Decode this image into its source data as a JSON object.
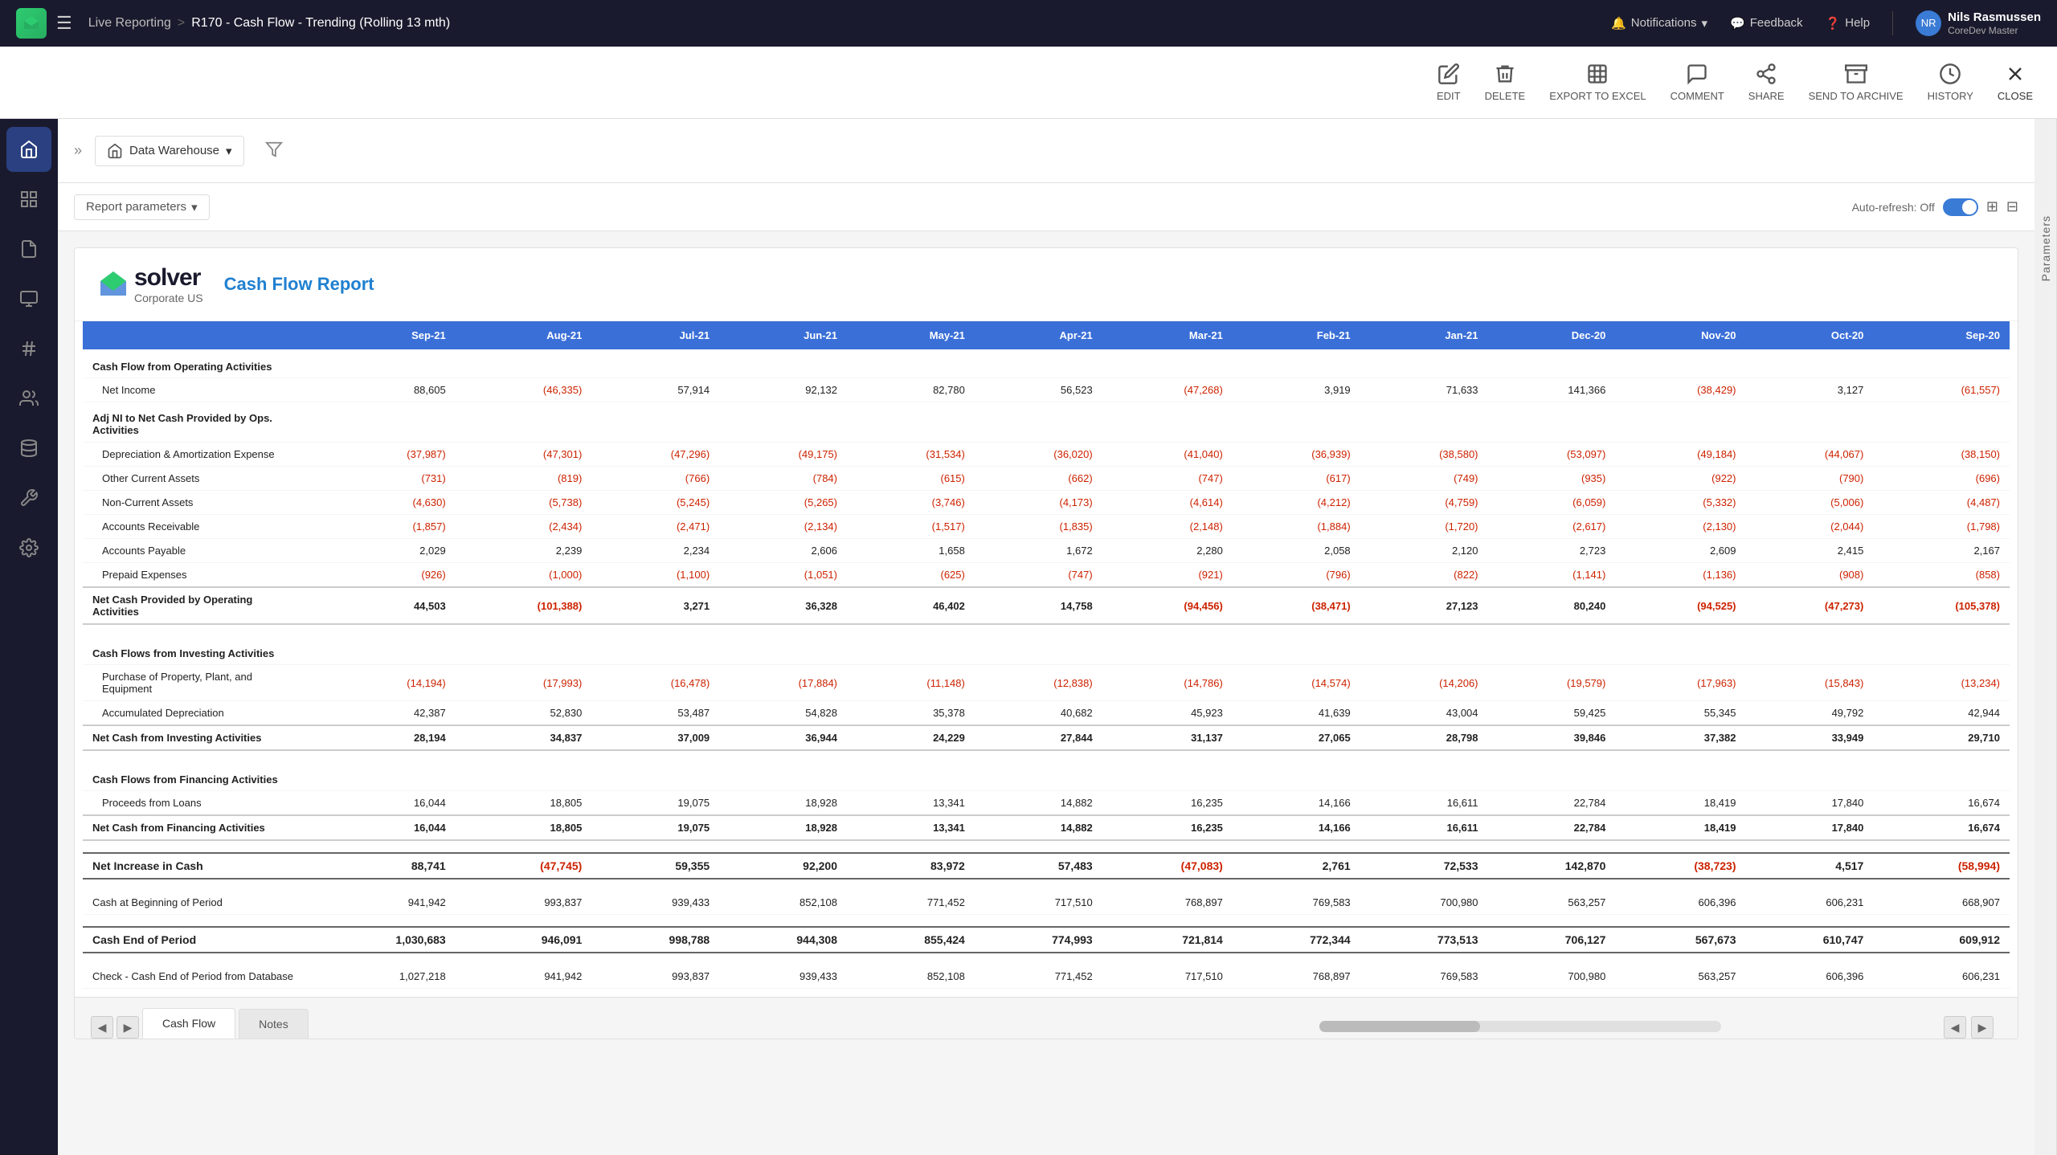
{
  "topNav": {
    "hamburger": "☰",
    "breadcrumb": {
      "parent": "Live Reporting",
      "separator": ">",
      "current": "R170 - Cash Flow - Trending (Rolling 13 mth)"
    },
    "notifications": "Notifications",
    "feedback": "Feedback",
    "help": "Help",
    "user": {
      "name": "Nils Rasmussen",
      "role": "CoreDev Master",
      "initials": "NR"
    }
  },
  "toolbar": {
    "edit": "EDIT",
    "delete": "DELETE",
    "exportToExcel": "EXPORT TO EXCEL",
    "comment": "COMMENT",
    "share": "SHARE",
    "sendToArchive": "SEND TO ARCHIVE",
    "history": "HISTORY",
    "close": "CLOSE"
  },
  "sidebar": {
    "items": [
      {
        "icon": "⌂",
        "label": "home"
      },
      {
        "icon": "📊",
        "label": "reports"
      },
      {
        "icon": "📋",
        "label": "documents"
      },
      {
        "icon": "📄",
        "label": "pages"
      },
      {
        "icon": "🔢",
        "label": "numbers"
      },
      {
        "icon": "👥",
        "label": "users"
      },
      {
        "icon": "🗂",
        "label": "data"
      },
      {
        "icon": "⚙",
        "label": "tools"
      },
      {
        "icon": "⚙️",
        "label": "settings"
      }
    ]
  },
  "params": {
    "label": "Parameters",
    "filterIcon": "▼"
  },
  "contentHeader": {
    "expandIcon": "»",
    "warehouse": "Data Warehouse",
    "warehouseIcon": "📦",
    "dropdownIcon": "▾"
  },
  "reportControls": {
    "paramsBtn": "Report parameters",
    "paramsBtnIcon": "▾",
    "autoRefreshLabel": "Auto-refresh: Off"
  },
  "report": {
    "logoText": "solver",
    "logoSubtitle": "Corporate US",
    "title": "Cash Flow Report",
    "columns": [
      "Sep-21",
      "Aug-21",
      "Jul-21",
      "Jun-21",
      "May-21",
      "Apr-21",
      "Mar-21",
      "Feb-21",
      "Jan-21",
      "Dec-20",
      "Nov-20",
      "Oct-20",
      "Sep-20"
    ],
    "sections": [
      {
        "type": "section-header",
        "label": "Cash Flow from Operating Activities",
        "values": [
          "",
          "",
          "",
          "",
          "",
          "",
          "",
          "",
          "",
          "",
          "",
          "",
          ""
        ]
      },
      {
        "type": "sub-item",
        "label": "Net Income",
        "values": [
          "88,605",
          "(46,335)",
          "57,914",
          "92,132",
          "82,780",
          "56,523",
          "(47,268)",
          "3,919",
          "71,633",
          "141,366",
          "(38,429)",
          "3,127",
          "(61,557)"
        ],
        "negatives": [
          false,
          true,
          false,
          false,
          false,
          false,
          true,
          false,
          false,
          false,
          true,
          false,
          true
        ]
      },
      {
        "type": "subsection-header",
        "label": "Adj NI to Net Cash Provided by Ops. Activities",
        "values": [
          "",
          "",
          "",
          "",
          "",
          "",
          "",
          "",
          "",
          "",
          "",
          "",
          ""
        ]
      },
      {
        "type": "sub-item",
        "label": "Depreciation & Amortization Expense",
        "values": [
          "(37,987)",
          "(47,301)",
          "(47,296)",
          "(49,175)",
          "(31,534)",
          "(36,020)",
          "(41,040)",
          "(36,939)",
          "(38,580)",
          "(53,097)",
          "(49,184)",
          "(44,067)",
          "(38,150)"
        ],
        "negatives": [
          true,
          true,
          true,
          true,
          true,
          true,
          true,
          true,
          true,
          true,
          true,
          true,
          true
        ]
      },
      {
        "type": "sub-item",
        "label": "Other Current Assets",
        "values": [
          "(731)",
          "(819)",
          "(766)",
          "(784)",
          "(615)",
          "(662)",
          "(747)",
          "(617)",
          "(749)",
          "(935)",
          "(922)",
          "(790)",
          "(696)"
        ],
        "negatives": [
          true,
          true,
          true,
          true,
          true,
          true,
          true,
          true,
          true,
          true,
          true,
          true,
          true
        ]
      },
      {
        "type": "sub-item",
        "label": "Non-Current Assets",
        "values": [
          "(4,630)",
          "(5,738)",
          "(5,245)",
          "(5,265)",
          "(3,746)",
          "(4,173)",
          "(4,614)",
          "(4,212)",
          "(4,759)",
          "(6,059)",
          "(5,332)",
          "(5,006)",
          "(4,487)"
        ],
        "negatives": [
          true,
          true,
          true,
          true,
          true,
          true,
          true,
          true,
          true,
          true,
          true,
          true,
          true
        ]
      },
      {
        "type": "sub-item",
        "label": "Accounts Receivable",
        "values": [
          "(1,857)",
          "(2,434)",
          "(2,471)",
          "(2,134)",
          "(1,517)",
          "(1,835)",
          "(2,148)",
          "(1,884)",
          "(1,720)",
          "(2,617)",
          "(2,130)",
          "(2,044)",
          "(1,798)"
        ],
        "negatives": [
          true,
          true,
          true,
          true,
          true,
          true,
          true,
          true,
          true,
          true,
          true,
          true,
          true
        ]
      },
      {
        "type": "sub-item",
        "label": "Accounts Payable",
        "values": [
          "2,029",
          "2,239",
          "2,234",
          "2,606",
          "1,658",
          "1,672",
          "2,280",
          "2,058",
          "2,120",
          "2,723",
          "2,609",
          "2,415",
          "2,167"
        ],
        "negatives": [
          false,
          false,
          false,
          false,
          false,
          false,
          false,
          false,
          false,
          false,
          false,
          false,
          false
        ]
      },
      {
        "type": "sub-item",
        "label": "Prepaid Expenses",
        "values": [
          "(926)",
          "(1,000)",
          "(1,100)",
          "(1,051)",
          "(625)",
          "(747)",
          "(921)",
          "(796)",
          "(822)",
          "(1,141)",
          "(1,136)",
          "(908)",
          "(858)"
        ],
        "negatives": [
          true,
          true,
          true,
          true,
          true,
          true,
          true,
          true,
          true,
          true,
          true,
          true,
          true
        ]
      },
      {
        "type": "section-total",
        "label": "Net Cash Provided by Operating Activities",
        "values": [
          "44,503",
          "(101,388)",
          "3,271",
          "36,328",
          "46,402",
          "14,758",
          "(94,456)",
          "(38,471)",
          "27,123",
          "80,240",
          "(94,525)",
          "(47,273)",
          "(105,378)"
        ],
        "negatives": [
          false,
          true,
          false,
          false,
          false,
          false,
          true,
          true,
          false,
          false,
          true,
          true,
          true
        ]
      },
      {
        "type": "spacer"
      },
      {
        "type": "section-header",
        "label": "Cash Flows from Investing Activities",
        "values": [
          "",
          "",
          "",
          "",
          "",
          "",
          "",
          "",
          "",
          "",
          "",
          "",
          ""
        ]
      },
      {
        "type": "sub-item",
        "label": "Purchase of Property, Plant, and Equipment",
        "values": [
          "(14,194)",
          "(17,993)",
          "(16,478)",
          "(17,884)",
          "(11,148)",
          "(12,838)",
          "(14,786)",
          "(14,574)",
          "(14,206)",
          "(19,579)",
          "(17,963)",
          "(15,843)",
          "(13,234)"
        ],
        "negatives": [
          true,
          true,
          true,
          true,
          true,
          true,
          true,
          true,
          true,
          true,
          true,
          true,
          true
        ]
      },
      {
        "type": "sub-item",
        "label": "Accumulated Depreciation",
        "values": [
          "42,387",
          "52,830",
          "53,487",
          "54,828",
          "35,378",
          "40,682",
          "45,923",
          "41,639",
          "43,004",
          "59,425",
          "55,345",
          "49,792",
          "42,944"
        ],
        "negatives": [
          false,
          false,
          false,
          false,
          false,
          false,
          false,
          false,
          false,
          false,
          false,
          false,
          false
        ]
      },
      {
        "type": "section-total",
        "label": "Net Cash from Investing Activities",
        "values": [
          "28,194",
          "34,837",
          "37,009",
          "36,944",
          "24,229",
          "27,844",
          "31,137",
          "27,065",
          "28,798",
          "39,846",
          "37,382",
          "33,949",
          "29,710"
        ],
        "negatives": [
          false,
          false,
          false,
          false,
          false,
          false,
          false,
          false,
          false,
          false,
          false,
          false,
          false
        ]
      },
      {
        "type": "spacer"
      },
      {
        "type": "section-header",
        "label": "Cash Flows from Financing Activities",
        "values": [
          "",
          "",
          "",
          "",
          "",
          "",
          "",
          "",
          "",
          "",
          "",
          "",
          ""
        ]
      },
      {
        "type": "sub-item",
        "label": "Proceeds from Loans",
        "values": [
          "16,044",
          "18,805",
          "19,075",
          "18,928",
          "13,341",
          "14,882",
          "16,235",
          "14,166",
          "16,611",
          "22,784",
          "18,419",
          "17,840",
          "16,674"
        ],
        "negatives": [
          false,
          false,
          false,
          false,
          false,
          false,
          false,
          false,
          false,
          false,
          false,
          false,
          false
        ]
      },
      {
        "type": "section-total",
        "label": "Net Cash from Financing Activities",
        "values": [
          "16,044",
          "18,805",
          "19,075",
          "18,928",
          "13,341",
          "14,882",
          "16,235",
          "14,166",
          "16,611",
          "22,784",
          "18,419",
          "17,840",
          "16,674"
        ],
        "negatives": [
          false,
          false,
          false,
          false,
          false,
          false,
          false,
          false,
          false,
          false,
          false,
          false,
          false
        ]
      },
      {
        "type": "spacer"
      },
      {
        "type": "grand-total",
        "label": "Net Increase in Cash",
        "values": [
          "88,741",
          "(47,745)",
          "59,355",
          "92,200",
          "83,972",
          "57,483",
          "(47,083)",
          "2,761",
          "72,533",
          "142,870",
          "(38,723)",
          "4,517",
          "(58,994)"
        ],
        "negatives": [
          false,
          true,
          false,
          false,
          false,
          false,
          true,
          false,
          false,
          false,
          true,
          false,
          true
        ]
      },
      {
        "type": "spacer"
      },
      {
        "type": "plain",
        "label": "Cash at Beginning of Period",
        "values": [
          "941,942",
          "993,837",
          "939,433",
          "852,108",
          "771,452",
          "717,510",
          "768,897",
          "769,583",
          "700,980",
          "563,257",
          "606,396",
          "606,231",
          "668,907"
        ],
        "negatives": [
          false,
          false,
          false,
          false,
          false,
          false,
          false,
          false,
          false,
          false,
          false,
          false,
          false
        ]
      },
      {
        "type": "spacer"
      },
      {
        "type": "grand-total",
        "label": "Cash End of Period",
        "values": [
          "1,030,683",
          "946,091",
          "998,788",
          "944,308",
          "855,424",
          "774,993",
          "721,814",
          "772,344",
          "773,513",
          "706,127",
          "567,673",
          "610,747",
          "609,912"
        ],
        "negatives": [
          false,
          false,
          false,
          false,
          false,
          false,
          false,
          false,
          false,
          false,
          false,
          false,
          false
        ]
      },
      {
        "type": "spacer"
      },
      {
        "type": "plain",
        "label": "Check - Cash End of Period from Database",
        "values": [
          "1,027,218",
          "941,942",
          "993,837",
          "939,433",
          "852,108",
          "771,452",
          "717,510",
          "768,897",
          "769,583",
          "700,980",
          "563,257",
          "606,396",
          "606,231"
        ],
        "negatives": [
          false,
          false,
          false,
          false,
          false,
          false,
          false,
          false,
          false,
          false,
          false,
          false,
          false
        ]
      }
    ]
  },
  "tabs": {
    "items": [
      "Cash Flow",
      "Notes"
    ],
    "active": "Cash Flow"
  }
}
